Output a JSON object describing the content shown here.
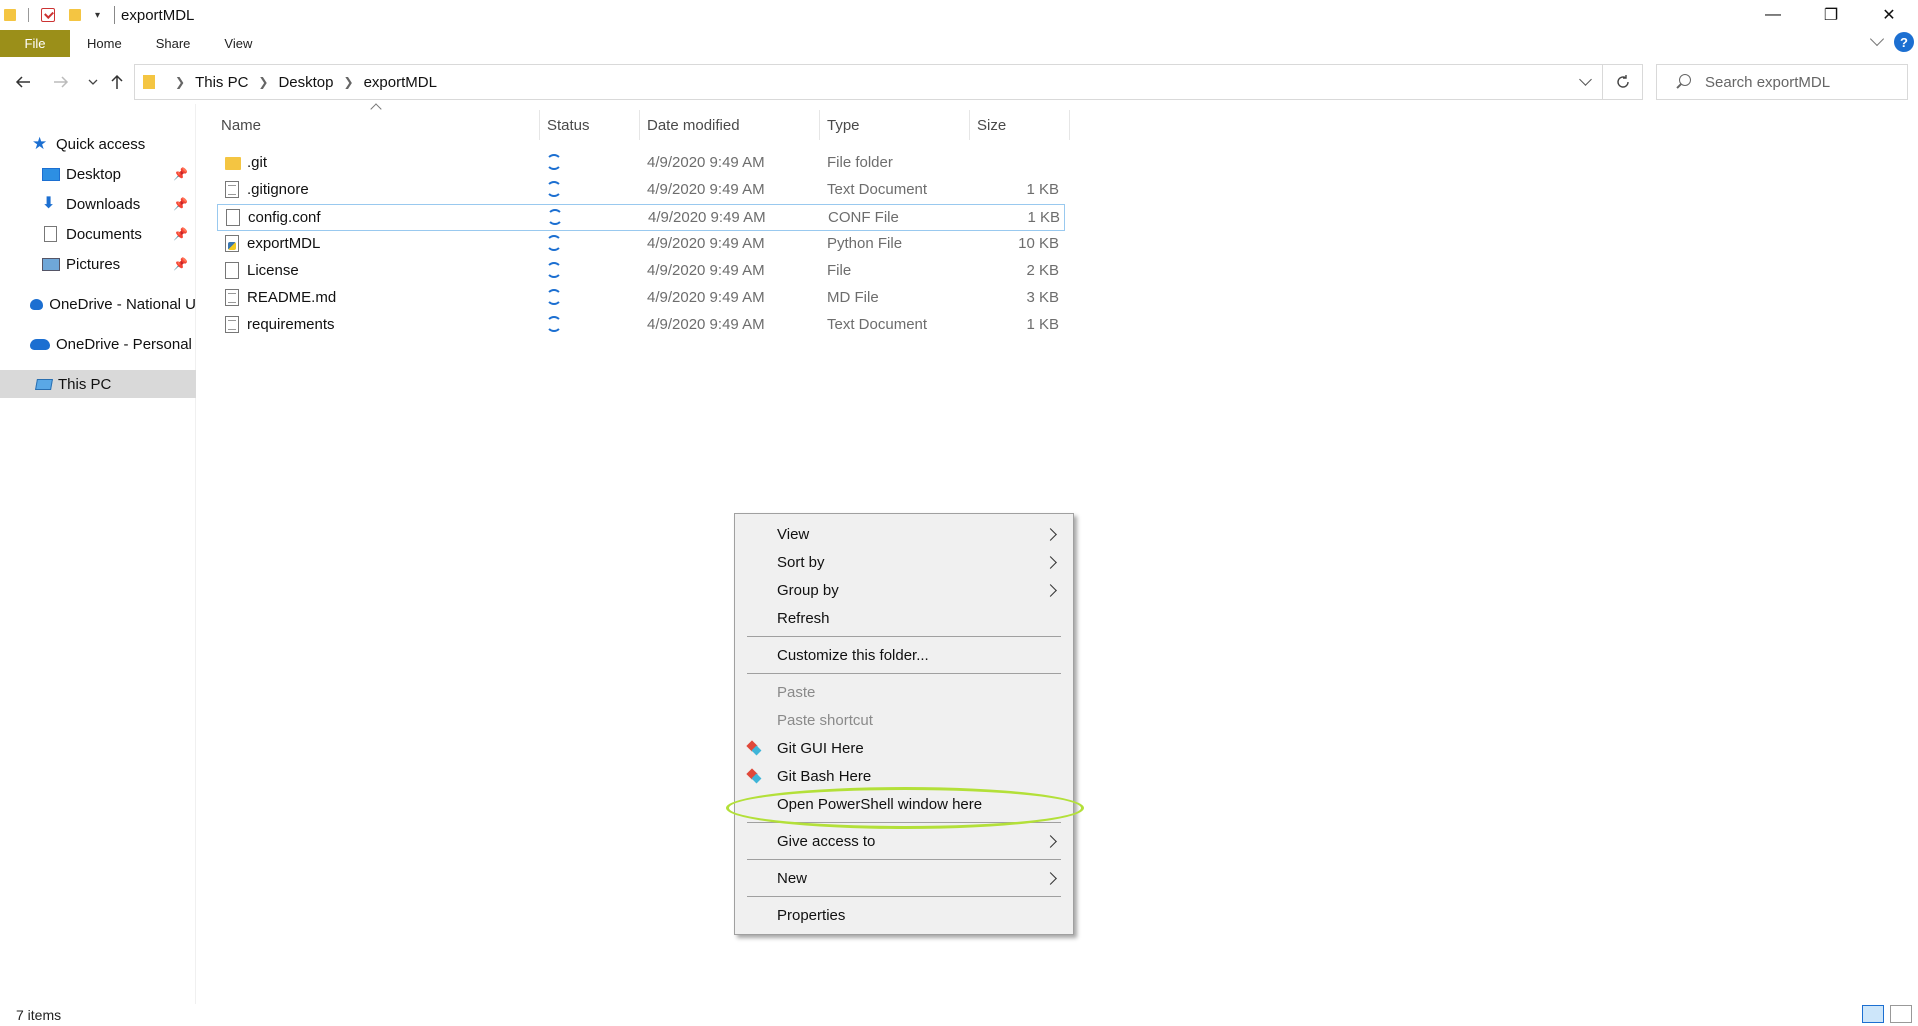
{
  "window": {
    "title": "exportMDL",
    "controls": [
      "—",
      "❐",
      "✕"
    ]
  },
  "ribbon": {
    "tabs": [
      "File",
      "Home",
      "Share",
      "View"
    ],
    "help": "?"
  },
  "address": {
    "crumbs": [
      "This PC",
      "Desktop",
      "exportMDL"
    ],
    "search_placeholder": "Search exportMDL"
  },
  "sidebar": {
    "items": [
      {
        "label": "Quick access",
        "icon": "star-icon"
      },
      {
        "label": "Desktop",
        "icon": "desktop-icon",
        "pinned": true
      },
      {
        "label": "Downloads",
        "icon": "download-icon",
        "pinned": true
      },
      {
        "label": "Documents",
        "icon": "documents-icon",
        "pinned": true
      },
      {
        "label": "Pictures",
        "icon": "pictures-icon",
        "pinned": true
      },
      {
        "label": "OneDrive - National U",
        "icon": "onedrive-icon"
      },
      {
        "label": "OneDrive - Personal",
        "icon": "onedrive-icon"
      },
      {
        "label": "This PC",
        "icon": "this-pc-icon",
        "selected": true
      }
    ]
  },
  "columns": [
    "Name",
    "Status",
    "Date modified",
    "Type",
    "Size"
  ],
  "files": [
    {
      "name": ".git",
      "date": "4/9/2020 9:49 AM",
      "type": "File folder",
      "size": "",
      "icon": "folder-icon"
    },
    {
      "name": ".gitignore",
      "date": "4/9/2020 9:49 AM",
      "type": "Text Document",
      "size": "1 KB",
      "icon": "text-file-icon"
    },
    {
      "name": "config.conf",
      "date": "4/9/2020 9:49 AM",
      "type": "CONF File",
      "size": "1 KB",
      "icon": "file-icon"
    },
    {
      "name": "exportMDL",
      "date": "4/9/2020 9:49 AM",
      "type": "Python File",
      "size": "10 KB",
      "icon": "python-file-icon"
    },
    {
      "name": "License",
      "date": "4/9/2020 9:49 AM",
      "type": "File",
      "size": "2 KB",
      "icon": "file-icon"
    },
    {
      "name": "README.md",
      "date": "4/9/2020 9:49 AM",
      "type": "MD File",
      "size": "3 KB",
      "icon": "text-file-icon"
    },
    {
      "name": "requirements",
      "date": "4/9/2020 9:49 AM",
      "type": "Text Document",
      "size": "1 KB",
      "icon": "text-file-icon"
    }
  ],
  "context_menu": {
    "view": "View",
    "sort_by": "Sort by",
    "group_by": "Group by",
    "refresh": "Refresh",
    "customize": "Customize this folder...",
    "paste": "Paste",
    "paste_shortcut": "Paste shortcut",
    "git_gui": "Git GUI Here",
    "git_bash": "Git Bash Here",
    "powershell": "Open PowerShell window here",
    "give_access": "Give access to",
    "new": "New",
    "properties": "Properties"
  },
  "status": {
    "item_count": "7 items"
  },
  "colors": {
    "file_tab": "#9b8f19",
    "accent": "#1c6fd1",
    "highlight_ring": "#b3e039"
  }
}
